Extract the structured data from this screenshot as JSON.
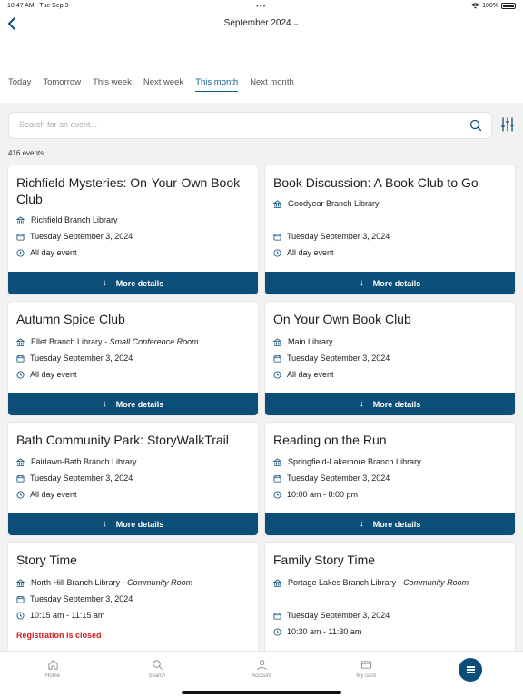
{
  "status_bar": {
    "time": "10:47 AM",
    "date": "Tue Sep 3",
    "battery": "100%"
  },
  "header": {
    "month": "September 2024"
  },
  "tabs": [
    {
      "label": "Today",
      "active": false
    },
    {
      "label": "Tomorrow",
      "active": false
    },
    {
      "label": "This week",
      "active": false
    },
    {
      "label": "Next week",
      "active": false
    },
    {
      "label": "This month",
      "active": true
    },
    {
      "label": "Next month",
      "active": false
    }
  ],
  "search": {
    "placeholder": "Search for an event..."
  },
  "results": {
    "count": "416 events"
  },
  "more_details_label": "More details",
  "events": [
    {
      "title": "Richfield Mysteries: On-Your-Own Book Club",
      "location": "Richfield Branch Library",
      "room": "",
      "date": "Tuesday September 3, 2024",
      "time": "All day event",
      "registration": ""
    },
    {
      "title": "Book Discussion: A Book Club to Go",
      "location": "Goodyear Branch Library",
      "room": "",
      "date": "Tuesday September 3, 2024",
      "time": "All day event",
      "registration": ""
    },
    {
      "title": "Autumn Spice Club",
      "location": "Ellet Branch Library",
      "room": "- Small Conference Room",
      "date": "Tuesday September 3, 2024",
      "time": "All day event",
      "registration": ""
    },
    {
      "title": "On Your Own Book Club",
      "location": "Main Library",
      "room": "",
      "date": "Tuesday September 3, 2024",
      "time": "All day event",
      "registration": ""
    },
    {
      "title": "Bath Community Park: StoryWalkTrail",
      "location": "Fairlawn-Bath Branch Library",
      "room": "",
      "date": "Tuesday September 3, 2024",
      "time": "All day event",
      "registration": ""
    },
    {
      "title": "Reading on the Run",
      "location": "Springfield-Lakemore Branch Library",
      "room": "",
      "date": "Tuesday September 3, 2024",
      "time": "10:00 am - 8:00 pm",
      "registration": ""
    },
    {
      "title": "Story Time",
      "location": "North Hill Branch Library",
      "room": "- Community Room",
      "date": "Tuesday September 3, 2024",
      "time": "10:15 am - 11:15 am",
      "registration": "Registration is closed"
    },
    {
      "title": "Family Story Time",
      "location": "Portage Lakes Branch Library",
      "room": "- Community Room",
      "date": "Tuesday September 3, 2024",
      "time": "10:30 am - 11:30 am",
      "registration": ""
    }
  ],
  "bottom_nav": [
    {
      "label": "Home",
      "icon": "home-icon"
    },
    {
      "label": "Search",
      "icon": "search-icon"
    },
    {
      "label": "Account",
      "icon": "account-icon"
    },
    {
      "label": "My card",
      "icon": "card-icon"
    }
  ],
  "colors": {
    "primary": "#0b4f78",
    "active_tab": "#0b5c8f",
    "error": "#d21c1c"
  }
}
